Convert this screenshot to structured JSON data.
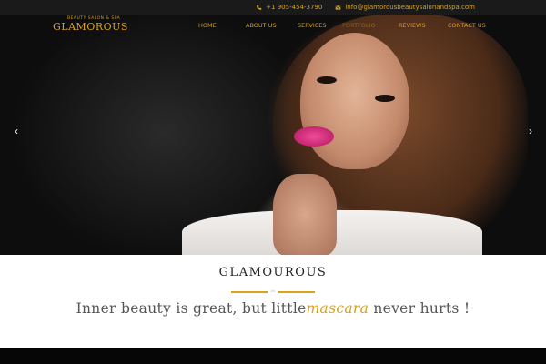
{
  "topbar": {
    "phone": "+1 905-454-3790",
    "email": "info@glamorousbeautysalonandspa.com",
    "phone_icon": "phone-icon",
    "email_icon": "envelope-icon"
  },
  "logo": {
    "tagline": "BEAUTY SALON & SPA",
    "name": "GLAMOROUS"
  },
  "nav": {
    "items": [
      "HOME",
      "ABOUT US",
      "SERVICES",
      "PORTFOLIO",
      "REVIEWS",
      "CONTACT US"
    ]
  },
  "slider": {
    "prev_icon": "chevron-left-icon",
    "next_icon": "chevron-right-icon",
    "prev_glyph": "‹",
    "next_glyph": "›"
  },
  "intro": {
    "title": "GLAMOUROUS",
    "quote_before": "Inner beauty is great, but little",
    "quote_highlight": "mascara",
    "quote_after": " never hurts !",
    "divider_glyph": "✂"
  },
  "colors": {
    "accent": "#d9a21b",
    "topbar_bg": "#1a1a1a",
    "text": "#555555"
  }
}
